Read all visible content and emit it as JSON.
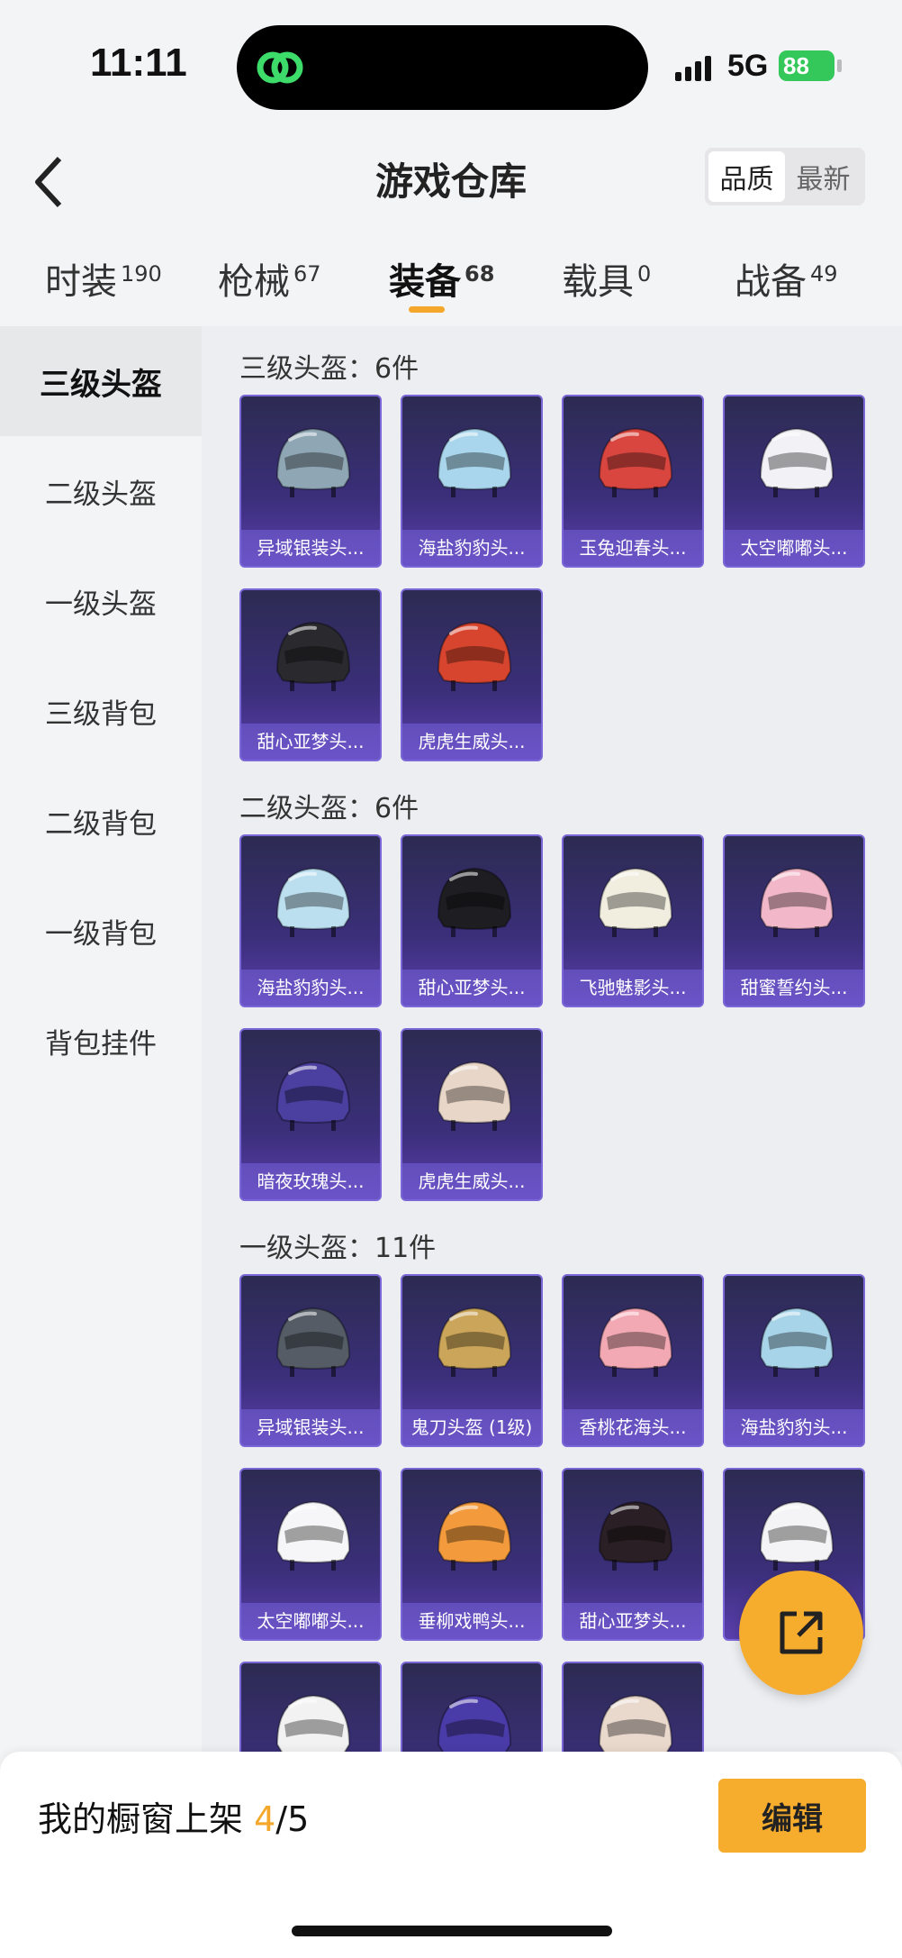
{
  "status_bar": {
    "time": "11:11",
    "network": "5G",
    "battery": "88"
  },
  "header": {
    "title": "游戏仓库",
    "sort_options": [
      "品质",
      "最新"
    ],
    "active_sort": "品质"
  },
  "tabs": [
    {
      "label": "时装",
      "count": "190"
    },
    {
      "label": "枪械",
      "count": "67"
    },
    {
      "label": "装备",
      "count": "68"
    },
    {
      "label": "载具",
      "count": "0"
    },
    {
      "label": "战备",
      "count": "49"
    }
  ],
  "active_tab": "装备",
  "sidebar": {
    "items": [
      "三级头盔",
      "二级头盔",
      "一级头盔",
      "三级背包",
      "二级背包",
      "一级背包",
      "背包挂件"
    ],
    "active": "三级头盔"
  },
  "sections": [
    {
      "title": "三级头盔：6件",
      "items": [
        {
          "name": "异域银装头...",
          "icon": "helmet-silver-goggles-icon",
          "color": "#8fa6b4"
        },
        {
          "name": "海盐豹豹头...",
          "icon": "helmet-seal-icon",
          "color": "#a9d6ec"
        },
        {
          "name": "玉兔迎春头...",
          "icon": "helmet-rabbit-red-icon",
          "color": "#d9463f"
        },
        {
          "name": "太空嘟嘟头...",
          "icon": "helmet-space-bunny-icon",
          "color": "#f2f2f6"
        },
        {
          "name": "甜心亚梦头...",
          "icon": "helmet-sweetheart-icon",
          "color": "#2a2a2e"
        },
        {
          "name": "虎虎生威头...",
          "icon": "helmet-tiger-icon",
          "color": "#d8452f"
        }
      ]
    },
    {
      "title": "二级头盔：6件",
      "items": [
        {
          "name": "海盐豹豹头...",
          "icon": "helmet-seal-icon",
          "color": "#bcdff0"
        },
        {
          "name": "甜心亚梦头...",
          "icon": "helmet-sweetheart-icon",
          "color": "#1e1e22"
        },
        {
          "name": "飞驰魅影头...",
          "icon": "helmet-phantom-icon",
          "color": "#f1eee0"
        },
        {
          "name": "甜蜜誓约头...",
          "icon": "helmet-sweet-vow-icon",
          "color": "#f2b8c9"
        },
        {
          "name": "暗夜玫瑰头...",
          "icon": "helmet-night-rose-icon",
          "color": "#4b3fa0"
        },
        {
          "name": "虎虎生威头...",
          "icon": "helmet-tiger-icon",
          "color": "#e8d6c8"
        }
      ]
    },
    {
      "title": "一级头盔：11件",
      "items": [
        {
          "name": "异域银装头...",
          "icon": "helmet-silver-icon",
          "color": "#555c66"
        },
        {
          "name": "鬼刀头盔 (1级)",
          "icon": "helmet-ghost-blade-icon",
          "color": "#caa55a"
        },
        {
          "name": "香桃花海头...",
          "icon": "helmet-peach-icon",
          "color": "#f3a9b4"
        },
        {
          "name": "海盐豹豹头...",
          "icon": "helmet-seal-icon",
          "color": "#a8d4ea"
        },
        {
          "name": "太空嘟嘟头...",
          "icon": "helmet-space-bunny-icon",
          "color": "#f6f6f8"
        },
        {
          "name": "垂柳戏鸭头...",
          "icon": "helmet-duck-icon",
          "color": "#f29a3c"
        },
        {
          "name": "甜心亚梦头...",
          "icon": "helmet-sweetheart-icon",
          "color": "#2a1f24"
        },
        {
          "name": "",
          "icon": "helmet-cat-icon",
          "color": "#f4f4f6"
        },
        {
          "name": "",
          "icon": "helmet-white-icon",
          "color": "#f2f2f2"
        },
        {
          "name": "",
          "icon": "helmet-galaxy-icon",
          "color": "#4a3ca8"
        },
        {
          "name": "",
          "icon": "helmet-tiger-icon",
          "color": "#e9d8cc"
        }
      ]
    }
  ],
  "bottom_bar": {
    "label": "我的橱窗上架 ",
    "current": "4",
    "total": "/5",
    "edit_label": "编辑"
  },
  "fab": {
    "icon": "share-external-icon"
  }
}
